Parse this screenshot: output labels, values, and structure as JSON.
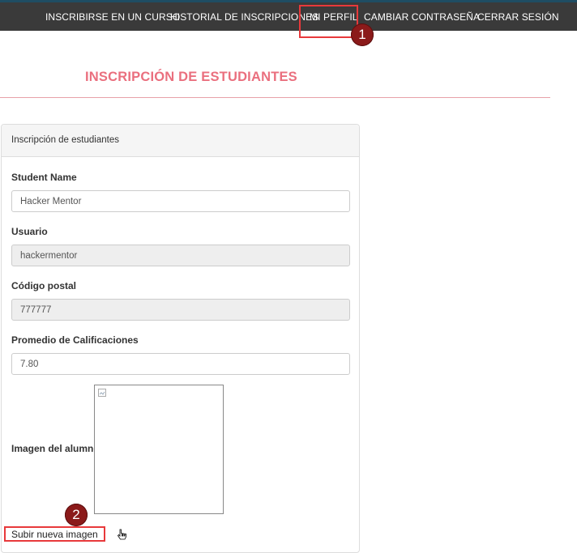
{
  "nav": {
    "items": [
      {
        "label": "INSCRIBIRSE EN UN CURSO"
      },
      {
        "label": "HISTORIAL DE INSCRIPCIONES"
      },
      {
        "label": "MI PERFIL"
      },
      {
        "label": "CAMBIAR CONTRASEÑA"
      },
      {
        "label": "CERRAR SESIÓN"
      }
    ]
  },
  "annotations": {
    "badge1": "1",
    "badge2": "2"
  },
  "page": {
    "title": "INSCRIPCIÓN DE ESTUDIANTES"
  },
  "form": {
    "heading": "Inscripción de estudiantes",
    "student_name_label": "Student Name",
    "student_name_value": "Hacker Mentor",
    "usuario_label": "Usuario",
    "usuario_value": "hackermentor",
    "postal_label": "Código postal",
    "postal_value": "777777",
    "promedio_label": "Promedio de Calificaciones",
    "promedio_value": "7.80",
    "imagen_label": "Imagen del alumno",
    "upload_label": "Subir nueva imagen"
  },
  "colors": {
    "nav_bg": "#3a3a3a",
    "title": "#ea6f7e",
    "highlight": "#e8393b",
    "badge": "#8b1a1a"
  }
}
